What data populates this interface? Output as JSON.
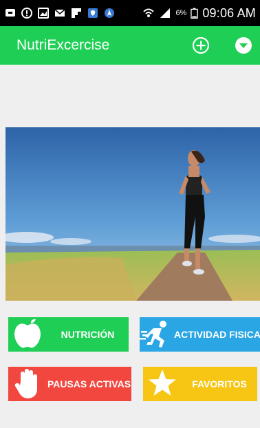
{
  "status_bar": {
    "battery_percent": "6%",
    "time": "09:06 AM",
    "icons": [
      "message-icon",
      "alert-icon",
      "image-icon",
      "email-icon",
      "flipboard-icon",
      "store-icon",
      "navigation-icon",
      "wifi-icon",
      "signal-icon",
      "battery-icon"
    ]
  },
  "app_bar": {
    "title": "NutriExcercise",
    "actions": [
      "add-circle-icon",
      "dropdown-circle-icon"
    ],
    "color": "#1fcf55"
  },
  "hero": {
    "image": "woman-running-on-path-icon"
  },
  "menu": [
    {
      "label": "NUTRICIÓN",
      "icon": "apple-icon",
      "color": "#1fcf55"
    },
    {
      "label": "ACTIVIDAD FISICA",
      "icon": "running-person-icon",
      "color": "#2aa6e4"
    },
    {
      "label": "PAUSAS ACTIVAS",
      "icon": "hand-icon",
      "color": "#f2473f"
    },
    {
      "label": "FAVORITOS",
      "icon": "star-icon",
      "color": "#f7c614"
    }
  ]
}
